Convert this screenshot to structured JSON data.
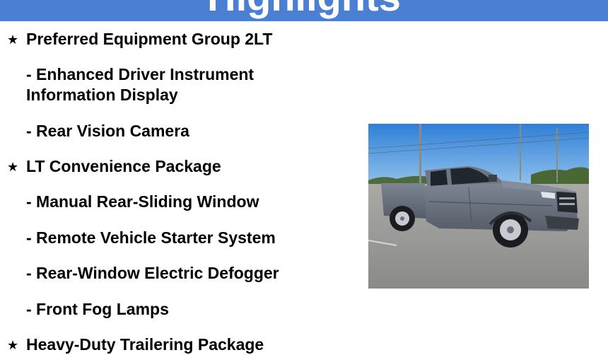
{
  "header": {
    "title": "Highlights",
    "color": "#4a7fd4"
  },
  "items": [
    {
      "type": "heading",
      "text": "Preferred Equipment Group 2LT",
      "icon": "star-icon"
    },
    {
      "type": "sub",
      "text": "- Enhanced Driver Instrument"
    },
    {
      "type": "sub-cont",
      "text": "Information Display"
    },
    {
      "type": "sub",
      "text": "- Rear Vision Camera"
    },
    {
      "type": "heading",
      "text": "LT Convenience Package",
      "icon": "star-icon"
    },
    {
      "type": "sub",
      "text": "- Manual Rear-Sliding Window"
    },
    {
      "type": "sub",
      "text": "- Remote Vehicle Starter System"
    },
    {
      "type": "sub",
      "text": "- Rear-Window Electric Defogger"
    },
    {
      "type": "sub",
      "text": "- Front Fog Lamps"
    },
    {
      "type": "heading",
      "text": "Heavy-Duty Trailering Package",
      "icon": "star-icon"
    }
  ],
  "photo": {
    "subject": "gray pickup truck in parking lot",
    "sky_color": "#3f86d6",
    "body_color": "#6b7380"
  }
}
